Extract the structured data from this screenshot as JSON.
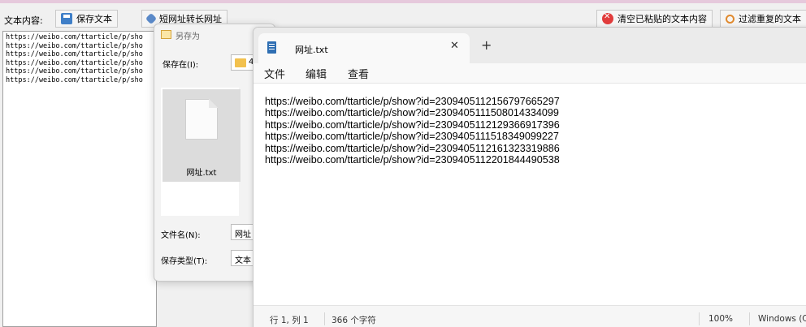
{
  "main_app": {
    "toolbar": {
      "content_label": "文本内容:",
      "save_button": "保存文本",
      "convert_button": "短网址转长网址",
      "clear_button": "清空已粘贴的文本内容",
      "filter_button": "过滤重复的文本"
    },
    "text_lines": [
      "https://weibo.com/ttarticle/p/sho",
      "https://weibo.com/ttarticle/p/sho",
      "https://weibo.com/ttarticle/p/sho",
      "https://weibo.com/ttarticle/p/sho",
      "https://weibo.com/ttarticle/p/sho",
      "https://weibo.com/ttarticle/p/sho"
    ]
  },
  "save_dialog": {
    "title": "另存为",
    "save_in_label": "保存在(I):",
    "folder_value": "4",
    "file_item": "网址.txt",
    "filename_label": "文件名(N):",
    "filename_value": "网址",
    "filetype_label": "保存类型(T):",
    "filetype_value": "文本"
  },
  "notepad": {
    "tab_title": "网址.txt",
    "close_glyph": "✕",
    "new_tab_glyph": "+",
    "menu": [
      "文件",
      "编辑",
      "查看"
    ],
    "content_lines": [
      "https://weibo.com/ttarticle/p/show?id=2309405112156797665297",
      "https://weibo.com/ttarticle/p/show?id=2309405111508014334099",
      "https://weibo.com/ttarticle/p/show?id=2309405112129366917396",
      "https://weibo.com/ttarticle/p/show?id=2309405111518349099227",
      "https://weibo.com/ttarticle/p/show?id=2309405112161323319886",
      "https://weibo.com/ttarticle/p/show?id=2309405112201844490538"
    ],
    "status": {
      "position": "行 1, 列 1",
      "char_count": "366 个字符",
      "zoom": "100%",
      "line_ending": "Windows (C"
    }
  },
  "colors": {
    "accent_strip": "#e6c9dc",
    "save_icon": "#3f7fc8",
    "clear_icon": "#e13c3c",
    "filter_icon": "#e0892d",
    "notepad_icon": "#2f6fb3"
  }
}
